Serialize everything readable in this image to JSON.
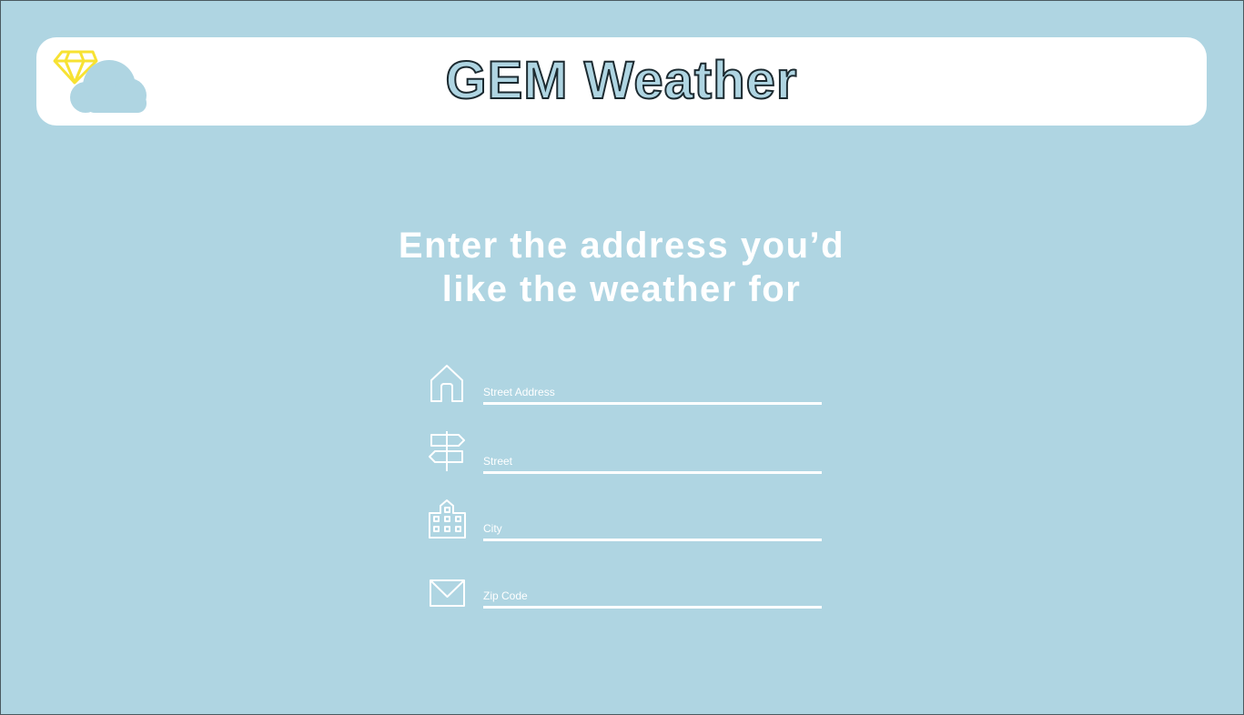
{
  "header": {
    "title": "GEM Weather",
    "logo_icon": "gem-cloud-logo",
    "colors": {
      "background": "#afd5e2",
      "gem": "#f7e232",
      "panel": "#ffffff"
    }
  },
  "main": {
    "heading_line1": "Enter the address you’d",
    "heading_line2": "like the weather for"
  },
  "form": {
    "fields": [
      {
        "icon": "house-icon",
        "placeholder": "Street Address",
        "value": ""
      },
      {
        "icon": "signpost-icon",
        "placeholder": "Street",
        "value": ""
      },
      {
        "icon": "buildings-icon",
        "placeholder": "City",
        "value": ""
      },
      {
        "icon": "envelope-icon",
        "placeholder": "Zip Code",
        "value": ""
      }
    ]
  }
}
